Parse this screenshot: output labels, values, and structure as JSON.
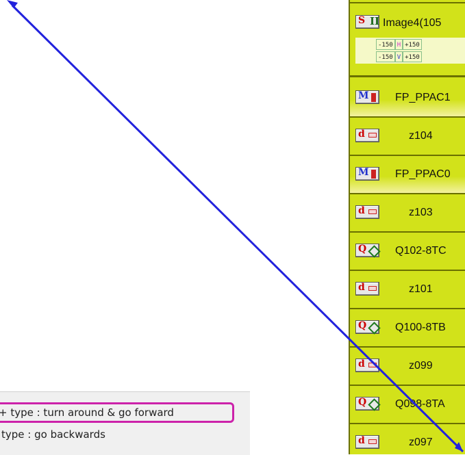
{
  "popup_menu": {
    "items": [
      "+ type : turn around & go forward",
      "type : go backwards"
    ]
  },
  "beamline": {
    "header": {
      "image_title": "Image4(105",
      "s_icon": "S",
      "roman_icon": "II",
      "range_h": {
        "min": "-150",
        "axis": "H",
        "max": "+150"
      },
      "range_v": {
        "min": "-150",
        "axis": "V",
        "max": "+150"
      }
    },
    "elements": [
      {
        "icon_letter": "M",
        "icon_name": "monitor-icon",
        "label": "FP_PPAC1"
      },
      {
        "icon_letter": "d",
        "icon_name": "drift-icon",
        "label": "z104"
      },
      {
        "icon_letter": "M",
        "icon_name": "monitor-icon",
        "label": "FP_PPAC0"
      },
      {
        "icon_letter": "d",
        "icon_name": "drift-icon",
        "label": "z103"
      },
      {
        "icon_letter": "Q",
        "icon_name": "quadrupole-icon",
        "label": "Q102-8TC"
      },
      {
        "icon_letter": "d",
        "icon_name": "drift-icon",
        "label": "z101"
      },
      {
        "icon_letter": "Q",
        "icon_name": "quadrupole-icon",
        "label": "Q100-8TB"
      },
      {
        "icon_letter": "d",
        "icon_name": "drift-icon",
        "label": "z099"
      },
      {
        "icon_letter": "Q",
        "icon_name": "quadrupole-icon",
        "label": "Q098-8TA"
      },
      {
        "icon_letter": "d",
        "icon_name": "drift-icon",
        "label": "z097"
      }
    ]
  },
  "colors": {
    "panel_bg": "#d2e21a",
    "highlight": "#cc22aa",
    "arrow": "#2222dd",
    "letter_red": "#cc0000",
    "letter_blue": "#2233cc"
  }
}
